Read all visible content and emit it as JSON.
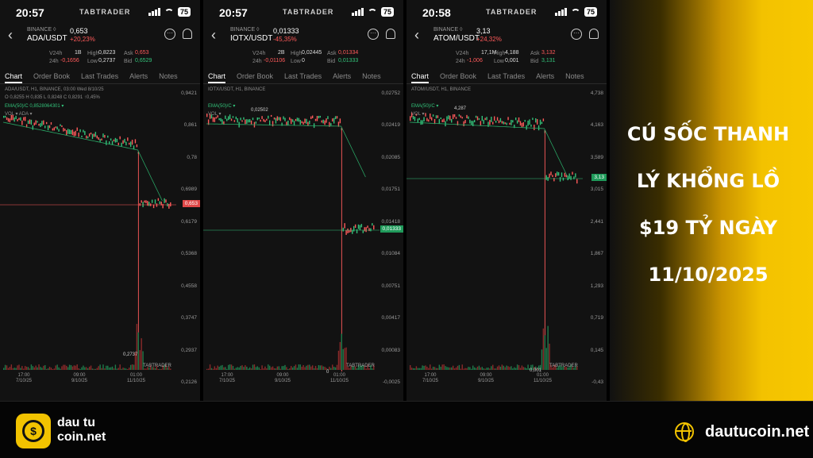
{
  "status": {
    "brand": "TABTRADER"
  },
  "tabs": [
    "Chart",
    "Order Book",
    "Last Trades",
    "Alerts",
    "Notes"
  ],
  "phones": [
    {
      "time": "20:57",
      "battery": "75",
      "exchange": "BINANCE ◊",
      "pair": "ADA/USDT",
      "price": "0,653",
      "change": "+20,23%",
      "v24h_label": "V24h",
      "v24h": "1B",
      "high_label": "High",
      "high": "0,8223",
      "ask_label": "Ask",
      "ask": "0,653",
      "d24h_label": "24h",
      "d24h": "-0,1656",
      "low_label": "Low",
      "low": "0,2737",
      "bid_label": "Bid",
      "bid": "0,6529",
      "info1": "ADA/USDT, H1, BINANCE, 03:00 Wed 8/10/25",
      "info2": "O 0,8255  H 0,835  L 0,8248  C 0,8291  ↑0,45%",
      "info3": "EMA(50)/C 0,8528064301 ▾",
      "info4": "VOL ▾  ADA ▾",
      "yaxis": [
        "0,9421",
        "0,861",
        "0,78",
        "0,6989",
        "0,6179",
        "0,5368",
        "0,4558",
        "0,3747",
        "0,2937",
        "0,2126"
      ],
      "xaxis": [
        [
          "17:00",
          "7/10/25"
        ],
        [
          "09:00",
          "9/10/25"
        ],
        [
          "01:00",
          "11/10/25"
        ]
      ],
      "current_tag": "0,653",
      "min_label": "0,2737",
      "watermark": "TABTRADER"
    },
    {
      "time": "20:57",
      "battery": "75",
      "exchange": "BINANCE ◊",
      "pair": "IOTX/USDT",
      "price": "0,01333",
      "change": "-45,35%",
      "v24h_label": "V24h",
      "v24h": "2B",
      "high_label": "High",
      "high": "0,02445",
      "ask_label": "Ask",
      "ask": "0,01334",
      "d24h_label": "24h",
      "d24h": "-0,01106",
      "low_label": "Low",
      "low": "0",
      "bid_label": "Bid",
      "bid": "0,01333",
      "info1": "IOTX/USDT, H1, BINANCE",
      "info2": "",
      "info3": "EMA(50)/C ▾",
      "info4": "VOL ▾",
      "yaxis": [
        "0,02752",
        "0,02419",
        "0,02085",
        "0,01751",
        "0,01418",
        "0,01084",
        "0,00751",
        "0,00417",
        "0,00083",
        "-0,0025"
      ],
      "xaxis": [
        [
          "17:00",
          "7/10/25"
        ],
        [
          "09:00",
          "9/10/25"
        ],
        [
          "01:00",
          "11/10/25"
        ]
      ],
      "current_tag": "0,01333",
      "max_label": "0,02502",
      "min_label": "0",
      "watermark": "TABTRADER"
    },
    {
      "time": "20:58",
      "battery": "75",
      "exchange": "BINANCE ◊",
      "pair": "ATOM/USDT",
      "price": "3,13",
      "change": "+24,32%",
      "v24h_label": "V24h",
      "v24h": "17,1M",
      "high_label": "High",
      "high": "4,188",
      "ask_label": "Ask",
      "ask": "3,132",
      "d24h_label": "24h",
      "d24h": "-1,006",
      "low_label": "Low",
      "low": "0,001",
      "bid_label": "Bid",
      "bid": "3,131",
      "info1": "ATOM/USDT, H1, BINANCE",
      "info2": "",
      "info3": "EMA(50)/C ▾",
      "info4": "VOL ▾",
      "yaxis": [
        "4,738",
        "4,163",
        "3,589",
        "3,015",
        "2,441",
        "1,867",
        "1,293",
        "0,719",
        "0,145",
        "-0,43"
      ],
      "xaxis": [
        [
          "17:00",
          "7/10/25"
        ],
        [
          "09:00",
          "9/10/25"
        ],
        [
          "01:00",
          "11/10/25"
        ]
      ],
      "current_tag": "3,13",
      "max_label": "4,287",
      "min_label": "0,001",
      "watermark": "TABTRADER"
    }
  ],
  "headline": [
    "CÚ SỐC THANH",
    "LÝ KHỔNG LỒ",
    "$19 TỶ NGÀY",
    "11/10/2025"
  ],
  "footer": {
    "logo_line1": "dau tu",
    "logo_line2": "coin.net",
    "site": "dautucoin.net"
  },
  "colors": {
    "up": "#33c27a",
    "down": "#ff5a5a",
    "accent": "#f2c300",
    "ema": "#2aa866"
  }
}
